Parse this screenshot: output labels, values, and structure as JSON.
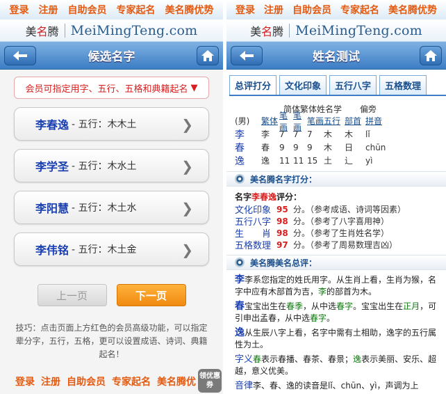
{
  "nav": {
    "login": "登录",
    "register": "注册",
    "vip": "自助会员",
    "expert": "专家起名",
    "advantage": "美名腾优势"
  },
  "brand": {
    "logo_cn_1": "美",
    "logo_cn_2": "名",
    "logo_cn_3": "腾",
    "logo_en": "MeiMingTeng.com"
  },
  "left": {
    "title": "候选名字",
    "notice": "会员可指定用字、五行、五格和典籍起名",
    "notice_arrow": "▼",
    "names": [
      {
        "name": "李春逸",
        "wuxing": "- 五行：木木土"
      },
      {
        "name": "李学圣",
        "wuxing": "- 五行：木水土"
      },
      {
        "name": "李阳慧",
        "wuxing": "- 五行：木土水"
      },
      {
        "name": "李伟铭",
        "wuxing": "- 五行：木土金"
      }
    ],
    "chevron": "❯",
    "prev": "上一页",
    "next": "下一页",
    "tips": "技巧：点击页面上方红色的会员高级功能，可以指定辈分字，五行，五格，更可以设置成语、诗词、典籍起名！",
    "bottom_nav": [
      "登录",
      "注册",
      "自助会员",
      "专家起名",
      "美名腾优"
    ],
    "coupon": "领优惠券"
  },
  "right": {
    "title": "姓名测试",
    "tabs": [
      "总评打分",
      "文化印象",
      "五行八字",
      "五格数理"
    ],
    "table_header_1": "简体繁体姓名学",
    "table_header_2": "偏旁",
    "gender": "(男)",
    "col_labels": [
      "繁体",
      "笔画",
      "笔画",
      "笔画",
      "五行",
      "部首",
      "拼音"
    ],
    "rows": [
      {
        "char": "李",
        "trad": "李",
        "s1": "7",
        "s2": "7",
        "s3": "7",
        "wx": "木",
        "bs": "木",
        "py": "lǐ"
      },
      {
        "char": "春",
        "trad": "春",
        "s1": "9",
        "s2": "9",
        "s3": "9",
        "wx": "木",
        "bs": "日",
        "py": "chūn"
      },
      {
        "char": "逸",
        "trad": "逸",
        "s1": "11",
        "s2": "11",
        "s3": "15",
        "wx": "土",
        "bs": "辶",
        "py": "yì"
      }
    ],
    "score_head": "美名腾名字打分：",
    "score_label": "名字",
    "score_name": "李春逸",
    "score_suffix": "评分：",
    "scores": [
      {
        "k": "文化印象",
        "v": "95",
        "n": "分。（参考成语、诗词等因素）"
      },
      {
        "k": "五行八字",
        "v": "98",
        "n": "分。（参考了八字喜用神）"
      },
      {
        "k": "生　　肖",
        "v": "98",
        "n": "分。（参考了生肖姓名学）"
      },
      {
        "k": "五格数理",
        "v": "97",
        "n": "分。（参考了周易数理吉凶）"
      }
    ],
    "summary_head": "美名腾美名总评：",
    "summary": {
      "p1_head": "李",
      "p1_a": "李系您指定的姓氏用字。从生肖上看，生肖为猴，名字中应有木部首为吉，",
      "p1_b": "李",
      "p1_c": "的部首为木。",
      "p2_head": "春",
      "p2_a": "宝宝出生在",
      "p2_b": "春季",
      "p2_c": "，从中选",
      "p2_d": "春字",
      "p2_e": "。宝宝出生在",
      "p2_f": "正月",
      "p2_g": "，可引申出孟春，从中选",
      "p2_h": "春字",
      "p2_i": "。",
      "p3_head": "逸",
      "p3_a": "从生辰八字上看，名字中需有土相助，逸字的五行属性为土。",
      "p4_head": "字义",
      "p4_a": "春",
      "p4_b": "表示春播、春茶、春景；",
      "p4_c": "逸",
      "p4_d": "表示美丽、安乐、超越，意义优美。",
      "p5_head": "音律",
      "p5_a": "李、春、逸的读音是lǐ、chūn、yì，声调为上"
    }
  }
}
